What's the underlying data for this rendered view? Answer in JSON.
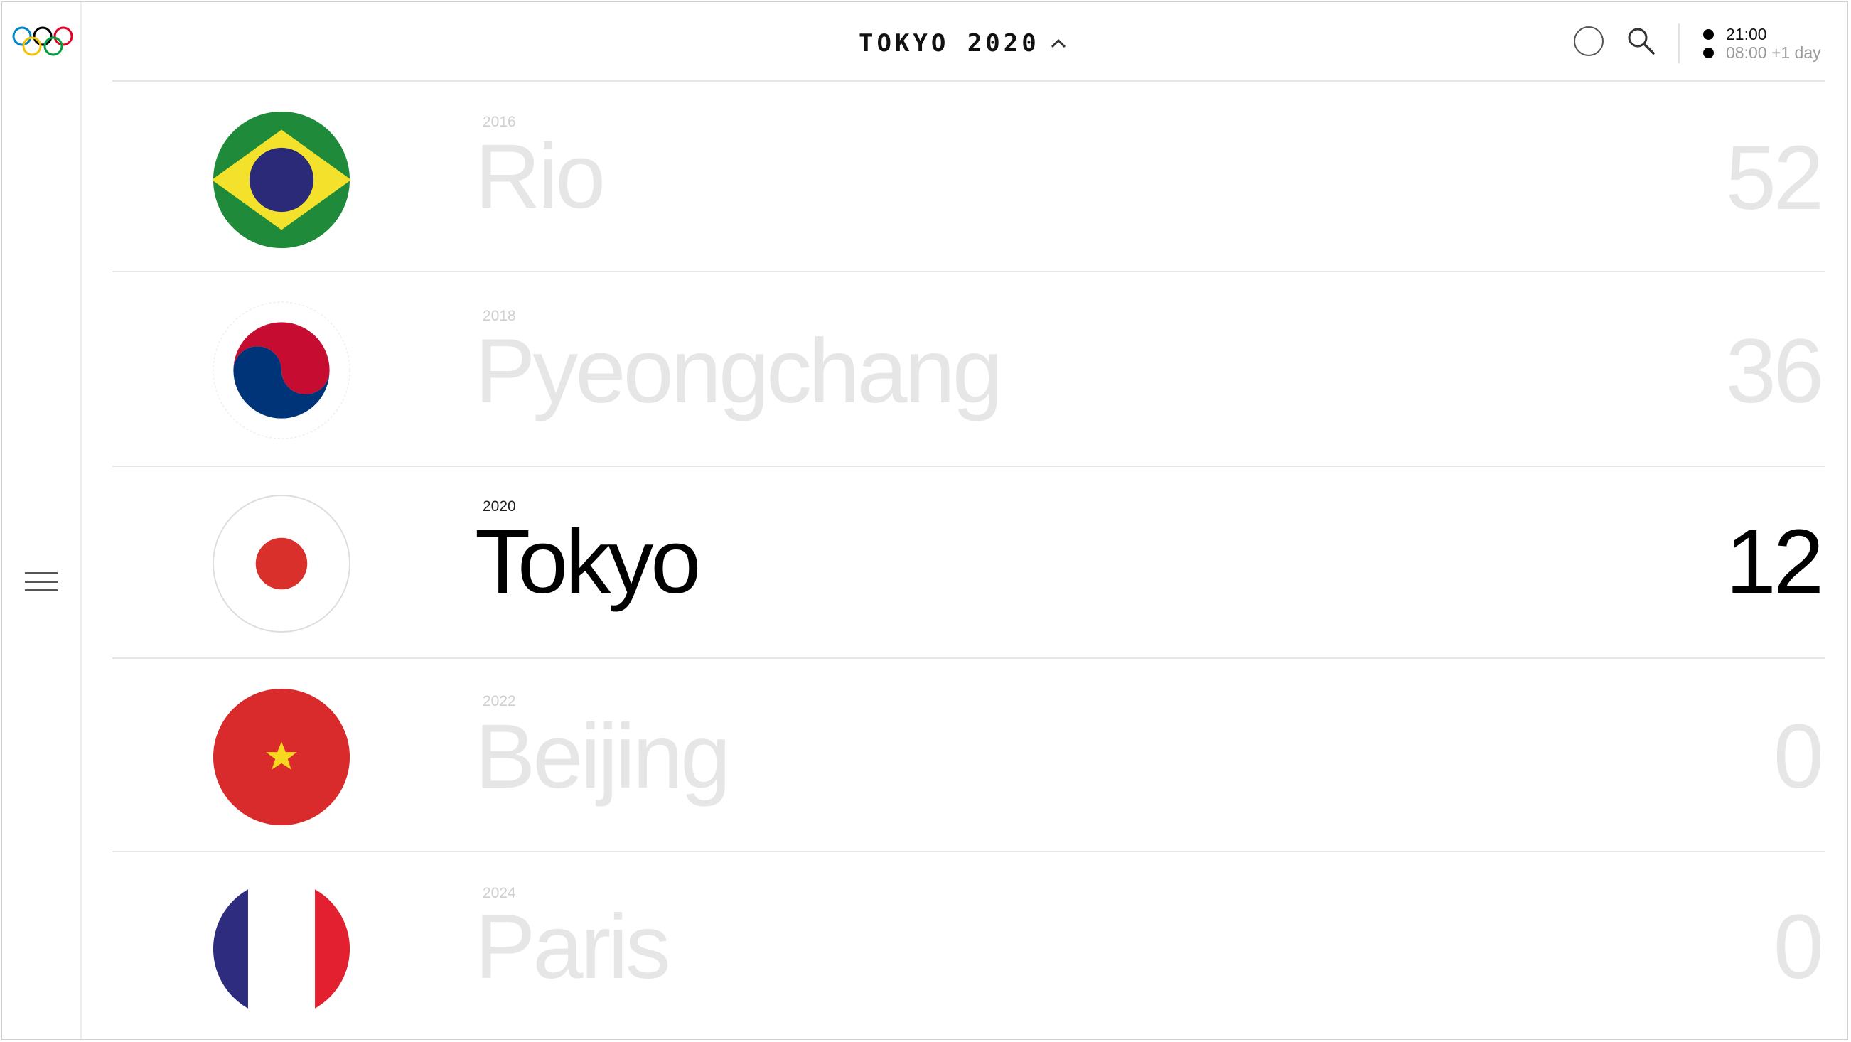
{
  "header": {
    "title": "TOKYO 2020",
    "times": [
      {
        "text": "21:00"
      },
      {
        "text": "08:00 +1 day"
      }
    ]
  },
  "icons": {
    "logo": "olympic-rings-icon",
    "menu": "hamburger-menu-icon",
    "chevron": "chevron-up-icon",
    "circle": "circle-icon",
    "search": "search-icon"
  },
  "games": [
    {
      "year": "2016",
      "city": "Rio",
      "count": "52",
      "flag": "brazil-flag-icon",
      "active": false
    },
    {
      "year": "2018",
      "city": "Pyeongchang",
      "count": "36",
      "flag": "south-korea-flag-icon",
      "active": false
    },
    {
      "year": "2020",
      "city": "Tokyo",
      "count": "12",
      "flag": "japan-flag-icon",
      "active": true
    },
    {
      "year": "2022",
      "city": "Beijing",
      "count": "0",
      "flag": "china-flag-icon",
      "active": false
    },
    {
      "year": "2024",
      "city": "Paris",
      "count": "0",
      "flag": "france-flag-icon",
      "active": false
    }
  ],
  "colors": {
    "active_text": "#000000",
    "faded_text": "#e6e6e6",
    "divider": "#e6e6e6"
  }
}
